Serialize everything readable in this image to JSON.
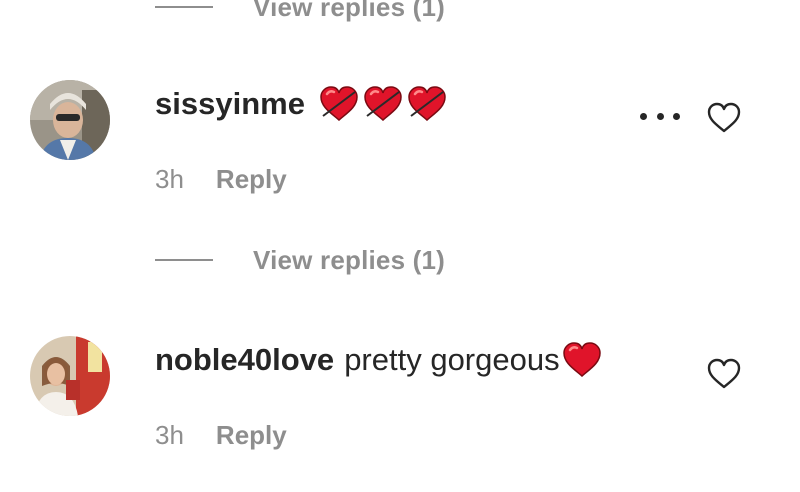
{
  "view_replies_label": "View replies (1)",
  "comments": [
    {
      "username": "sissyinme",
      "text": "",
      "hearts": 3,
      "time": "3h",
      "reply_label": "Reply",
      "avatar_icon": "user-avatar",
      "show_more": true
    },
    {
      "username": "noble40love",
      "text": "pretty gorgeous",
      "hearts": 1,
      "time": "3h",
      "reply_label": "Reply",
      "avatar_icon": "user-avatar",
      "show_more": false
    }
  ],
  "colors": {
    "text": "#262626",
    "secondary": "#8e8e8e",
    "heart_red": "#e0142a"
  }
}
